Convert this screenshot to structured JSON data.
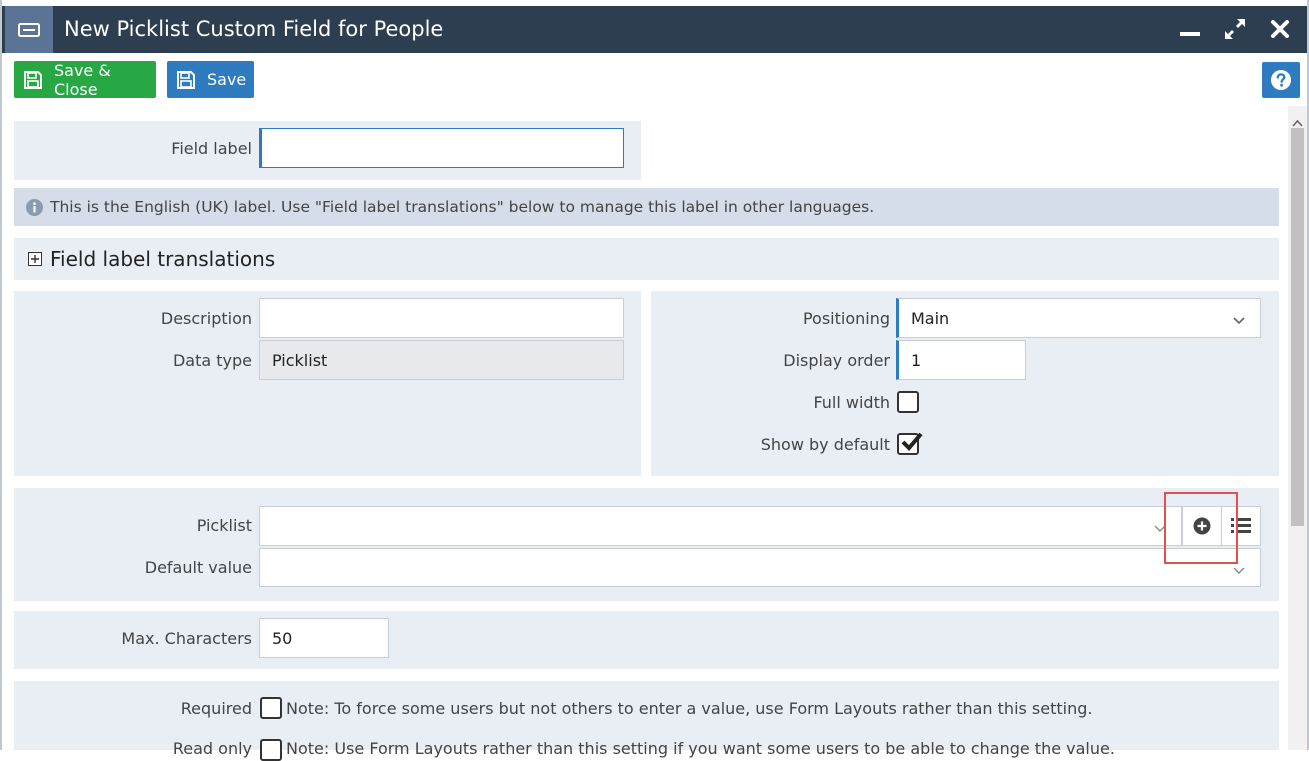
{
  "window": {
    "title": "New Picklist Custom Field for People"
  },
  "toolbar": {
    "save_close_label": "Save & Close",
    "save_label": "Save"
  },
  "form": {
    "field_label": {
      "label": "Field label",
      "value": ""
    },
    "info_text": "This is the English (UK) label. Use \"Field label translations\" below to manage this label in other languages.",
    "translations_heading": "Field label translations",
    "description": {
      "label": "Description",
      "value": ""
    },
    "data_type": {
      "label": "Data type",
      "value": "Picklist"
    },
    "positioning": {
      "label": "Positioning",
      "value": "Main"
    },
    "display_order": {
      "label": "Display order",
      "value": "1"
    },
    "full_width": {
      "label": "Full width",
      "checked": false
    },
    "show_by_default": {
      "label": "Show by default",
      "checked": true
    },
    "picklist": {
      "label": "Picklist",
      "value": ""
    },
    "default_value": {
      "label": "Default value",
      "value": ""
    },
    "max_characters": {
      "label": "Max. Characters",
      "value": "50"
    },
    "required": {
      "label": "Required",
      "checked": false,
      "note": "Note: To force some users but not others to enter a value, use Form Layouts rather than this setting."
    },
    "read_only": {
      "label": "Read only",
      "checked": false,
      "note": "Note: Use Form Layouts rather than this setting if you want some users to be able to change the value."
    }
  },
  "colors": {
    "titlebar": "#2d3e50",
    "save_close_button": "#28a745",
    "save_button": "#2f7bbf",
    "highlight_box": "#e0524f"
  },
  "icons": [
    "window-icon",
    "minimize-icon",
    "maximize-icon",
    "close-icon",
    "save-icon",
    "help-icon",
    "info-icon",
    "expand-icon",
    "chevron-down-icon",
    "add-circle-icon",
    "list-icon",
    "checkmark-icon"
  ]
}
